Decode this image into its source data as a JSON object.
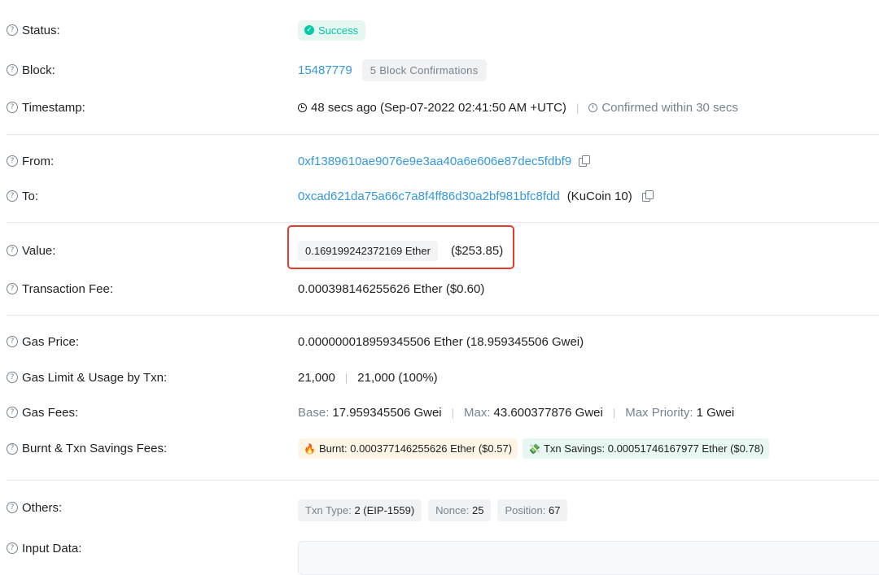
{
  "status": {
    "label": "Status:",
    "value": "Success"
  },
  "block": {
    "label": "Block:",
    "number": "15487779",
    "confirmations": "5 Block Confirmations"
  },
  "timestamp": {
    "label": "Timestamp:",
    "value": "48 secs ago (Sep-07-2022 02:41:50 AM +UTC)",
    "separator": "|",
    "confirmed": "Confirmed within 30 secs"
  },
  "from": {
    "label": "From:",
    "address": "0xf1389610ae9076e9e3aa40a6e606e87dec5fdbf9"
  },
  "to": {
    "label": "To:",
    "address": "0xcad621da75a66c7a8f4ff86d30a2bf981bfc8fdd",
    "name": "(KuCoin 10)"
  },
  "value": {
    "label": "Value:",
    "ether": "0.169199242372169 Ether",
    "usd": "($253.85)"
  },
  "txn_fee": {
    "label": "Transaction Fee:",
    "value": "0.000398146255626 Ether ($0.60)"
  },
  "gas_price": {
    "label": "Gas Price:",
    "value": "0.000000018959345506 Ether (18.959345506 Gwei)"
  },
  "gas_limit": {
    "label": "Gas Limit & Usage by Txn:",
    "limit": "21,000",
    "separator": "|",
    "usage": "21,000 (100%)"
  },
  "gas_fees": {
    "label": "Gas Fees:",
    "base_key": "Base:",
    "base_val": "17.959345506 Gwei",
    "separator": "|",
    "max_key": "Max:",
    "max_val": "43.600377876 Gwei",
    "priority_key": "Max Priority:",
    "priority_val": "1 Gwei"
  },
  "burnt": {
    "label": "Burnt & Txn Savings Fees:",
    "burnt_text": "Burnt: 0.000377146255626 Ether ($0.57)",
    "savings_text": "Txn Savings: 0.00051746167977 Ether ($0.78)",
    "burnt_icon": "fire-icon",
    "savings_icon": "money-icon"
  },
  "others": {
    "label": "Others:",
    "type_key": "Txn Type:",
    "type_val": "2 (EIP-1559)",
    "nonce_key": "Nonce:",
    "nonce_val": "25",
    "position_key": "Position:",
    "position_val": "67"
  },
  "input_data": {
    "label": "Input Data:"
  },
  "colors": {
    "link": "#3498db",
    "success": "#00c9a7",
    "highlight": "#e23b2e",
    "muted": "#77838f"
  }
}
